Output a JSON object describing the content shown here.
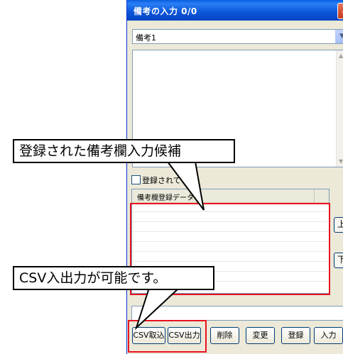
{
  "window": {
    "title": "備考の入力 0/0",
    "close_glyph": "X",
    "select_value": "備考1",
    "check_label": "登録されている",
    "list_header": "備考欄登録データ",
    "up_button": "上",
    "down_button": "下"
  },
  "buttons": {
    "csv_import": "CSV取込",
    "csv_export": "CSV出力",
    "delete": "削除",
    "change": "変更",
    "register": "登録",
    "input": "入力"
  },
  "annotations": {
    "memo_candidates": "登録された備考欄入力候補",
    "csv_note": "CSV入出力が可能です。"
  },
  "colors": {
    "highlight_red": "#e8131f",
    "titlebar_blue": "#0b55d8"
  },
  "icons": {
    "select_arrow": "chevron-down-icon",
    "close": "close-icon"
  }
}
